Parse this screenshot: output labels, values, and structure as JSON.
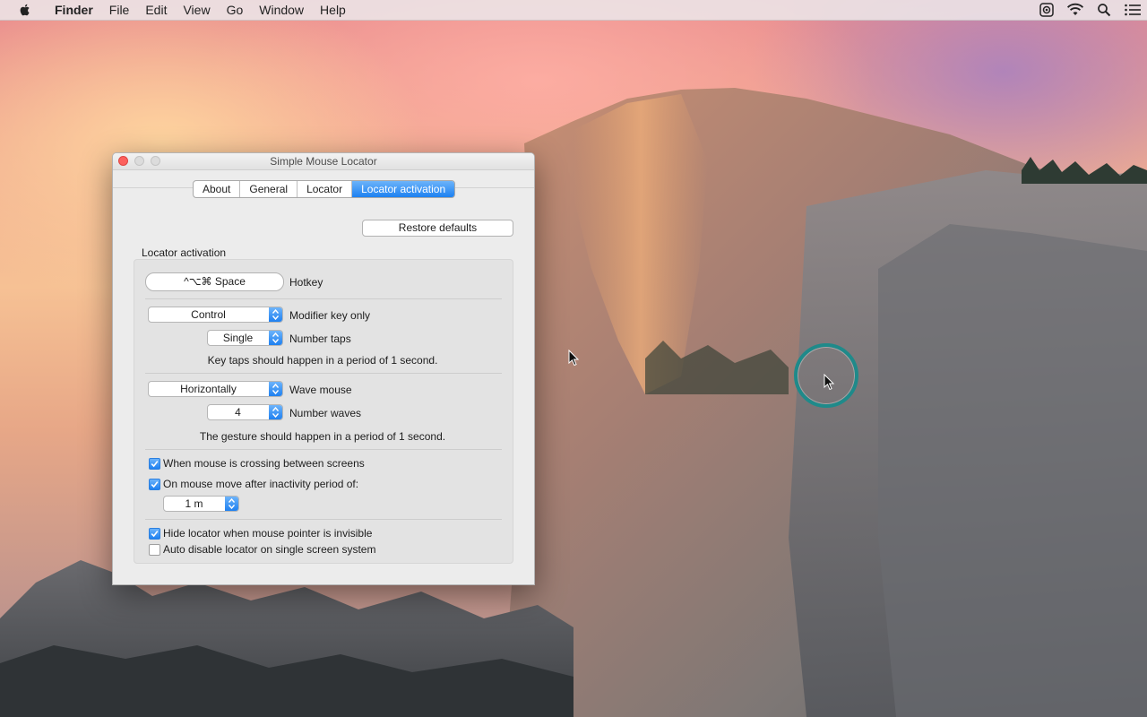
{
  "menubar": {
    "app": "Finder",
    "items": [
      "File",
      "Edit",
      "View",
      "Go",
      "Window",
      "Help"
    ]
  },
  "window": {
    "title": "Simple Mouse Locator",
    "tabs": [
      {
        "label": "About",
        "active": false
      },
      {
        "label": "General",
        "active": false
      },
      {
        "label": "Locator",
        "active": false
      },
      {
        "label": "Locator activation",
        "active": true
      }
    ],
    "restore_label": "Restore defaults",
    "section_title": "Locator activation",
    "hotkey": {
      "value": "^⌥⌘ Space",
      "label": "Hotkey"
    },
    "modifier": {
      "value": "Control",
      "label": "Modifier key only"
    },
    "taps": {
      "value": "Single",
      "label": "Number taps",
      "note": "Key taps should happen in a period of 1 second."
    },
    "wave": {
      "value": "Horizontally",
      "label": "Wave mouse"
    },
    "waves": {
      "value": "4",
      "label": "Number waves",
      "note": "The gesture should happen in a period of 1 second."
    },
    "crossing": {
      "label": "When mouse is crossing between screens",
      "checked": true
    },
    "inactivity": {
      "label": "On mouse move after inactivity period of:",
      "checked": true,
      "period": "1 m"
    },
    "hide_invisible": {
      "label": "Hide locator when mouse pointer is invisible",
      "checked": true
    },
    "auto_disable": {
      "label": "Auto disable locator on single screen system",
      "checked": false
    }
  },
  "icons": [
    "apple-icon",
    "screen-record-icon",
    "wifi-icon",
    "spotlight-icon",
    "notification-center-icon"
  ],
  "colors": {
    "accent": "#1d81f1",
    "locator_ring": "#1f8a8a",
    "close": "#fc605c"
  }
}
